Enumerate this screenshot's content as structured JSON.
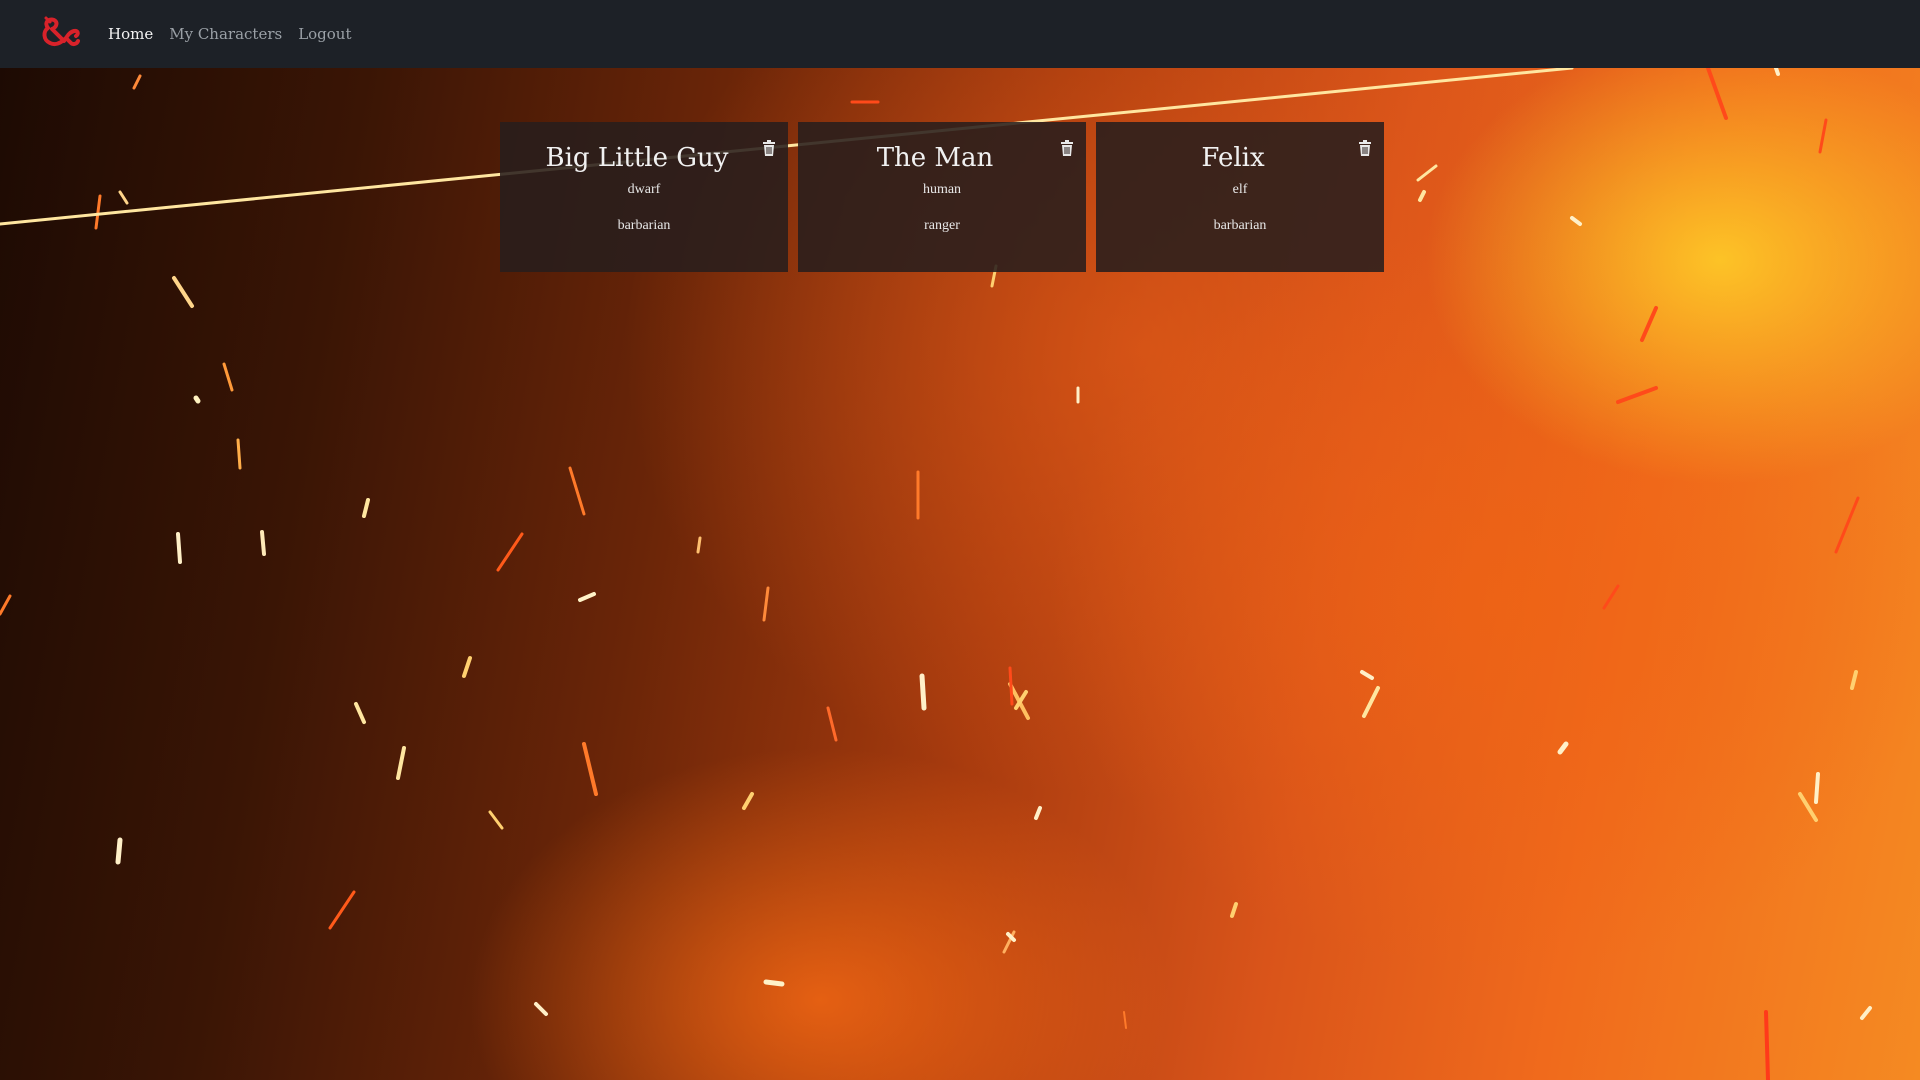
{
  "nav": {
    "logo_icon": "dnd-ampersand-logo-icon",
    "logo_color": "#d8222a",
    "links": [
      {
        "label": "Home",
        "active": true
      },
      {
        "label": "My Characters",
        "active": false
      },
      {
        "label": "Logout",
        "active": false
      }
    ]
  },
  "characters": [
    {
      "name": "Big Little Guy",
      "race": "dwarf",
      "class": "barbarian",
      "delete_icon": "trash-icon"
    },
    {
      "name": "The Man",
      "race": "human",
      "class": "ranger",
      "delete_icon": "trash-icon"
    },
    {
      "name": "Felix",
      "race": "elf",
      "class": "barbarian",
      "delete_icon": "trash-icon"
    }
  ],
  "theme": {
    "navbar_bg": "#1d2127",
    "card_bg": "rgba(40,30,28,0.88)",
    "background": "fire-embers"
  }
}
